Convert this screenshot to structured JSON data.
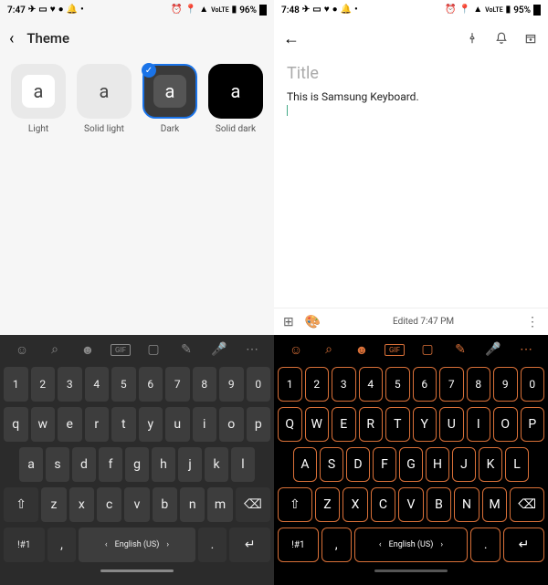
{
  "left": {
    "status": {
      "time": "7:47",
      "battery": "96%"
    },
    "header": {
      "title": "Theme"
    },
    "themes": [
      {
        "label": "Light",
        "letter": "a",
        "selected": false
      },
      {
        "label": "Solid light",
        "letter": "a",
        "selected": false
      },
      {
        "label": "Dark",
        "letter": "a",
        "selected": true
      },
      {
        "label": "Solid dark",
        "letter": "a",
        "selected": false
      }
    ],
    "keyboard": {
      "toolbar_icons": [
        "emoji",
        "search",
        "sticker",
        "gif",
        "clipboard",
        "edit",
        "mic",
        "more"
      ],
      "row_num": [
        "1",
        "2",
        "3",
        "4",
        "5",
        "6",
        "7",
        "8",
        "9",
        "0"
      ],
      "row1": [
        "q",
        "w",
        "e",
        "r",
        "t",
        "y",
        "u",
        "i",
        "o",
        "p"
      ],
      "row2": [
        "a",
        "s",
        "d",
        "f",
        "g",
        "h",
        "j",
        "k",
        "l"
      ],
      "row3": [
        "z",
        "x",
        "c",
        "v",
        "b",
        "n",
        "m"
      ],
      "sym": "!#1",
      "comma": ",",
      "space": "English (US)",
      "dot": "."
    }
  },
  "right": {
    "status": {
      "time": "7:48",
      "battery": "95%"
    },
    "note": {
      "title_placeholder": "Title",
      "body": "This is Samsung Keyboard.",
      "edited": "Edited 7:47 PM"
    },
    "keyboard": {
      "toolbar_icons": [
        "emoji",
        "search",
        "sticker",
        "gif",
        "clipboard",
        "edit",
        "mic",
        "more"
      ],
      "row_num": [
        "1",
        "2",
        "3",
        "4",
        "5",
        "6",
        "7",
        "8",
        "9",
        "0"
      ],
      "row1": [
        "Q",
        "W",
        "E",
        "R",
        "T",
        "Y",
        "U",
        "I",
        "O",
        "P"
      ],
      "row2": [
        "A",
        "S",
        "D",
        "F",
        "G",
        "H",
        "J",
        "K",
        "L"
      ],
      "row3": [
        "Z",
        "X",
        "C",
        "V",
        "B",
        "N",
        "M"
      ],
      "sym": "!#1",
      "comma": ",",
      "space": "English (US)",
      "dot": "."
    }
  }
}
